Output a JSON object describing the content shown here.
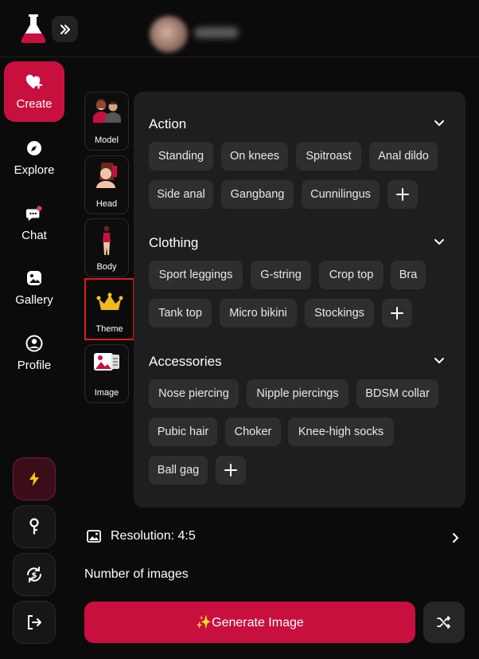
{
  "header": {
    "logo_icon": "flask-logo-icon",
    "expand_icon": "chevrons-right-icon"
  },
  "sidebar": {
    "items": [
      {
        "label": "Create",
        "icon": "heart-plus-icon",
        "active": true
      },
      {
        "label": "Explore",
        "icon": "compass-icon"
      },
      {
        "label": "Chat",
        "icon": "chat-icon"
      },
      {
        "label": "Gallery",
        "icon": "gallery-icon"
      },
      {
        "label": "Profile",
        "icon": "user-circle-icon"
      }
    ],
    "bottom_buttons": [
      "lightning-icon",
      "key-icon",
      "refresh-currency-icon",
      "logout-icon"
    ]
  },
  "categories": [
    {
      "label": "Model"
    },
    {
      "label": "Head"
    },
    {
      "label": "Body"
    },
    {
      "label": "Theme",
      "selected": true
    },
    {
      "label": "Image"
    }
  ],
  "sections": [
    {
      "title": "Action",
      "tags": [
        "Standing",
        "On knees",
        "Spitroast",
        "Anal dildo",
        "Side anal",
        "Gangbang",
        "Cunnilingus"
      ]
    },
    {
      "title": "Clothing",
      "tags": [
        "Sport leggings",
        "G-string",
        "Crop top",
        "Bra",
        "Tank top",
        "Micro bikini",
        "Stockings"
      ]
    },
    {
      "title": "Accessories",
      "tags": [
        "Nose piercing",
        "Nipple piercings",
        "BDSM collar",
        "Pubic hair",
        "Choker",
        "Knee-high socks",
        "Ball gag"
      ]
    }
  ],
  "resolution": {
    "label": "Resolution: 4:5"
  },
  "number_of_images": {
    "label": "Number of images"
  },
  "generate_button": {
    "label": "✨Generate Image"
  },
  "colors": {
    "accent": "#c8103f",
    "panel": "#1e1e1e",
    "tag": "#2e2e2e",
    "highlight": "#e11b1b"
  }
}
